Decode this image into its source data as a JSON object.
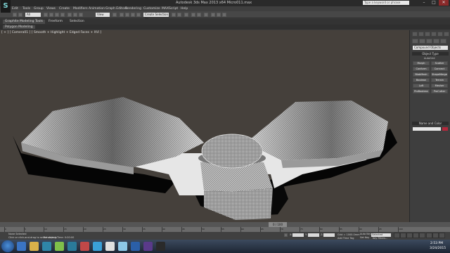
{
  "window": {
    "title": "Autodesk 3ds Max 2013 x64      Micro011.max",
    "search_placeholder": "Type a keyword or phrase",
    "minimize": "–",
    "maximize": "□",
    "close": "✕"
  },
  "app_logo": "S",
  "menu": [
    "Edit",
    "Tools",
    "Group",
    "Views",
    "Create",
    "Modifiers",
    "Animation",
    "Graph Editors",
    "Rendering",
    "Customize",
    "MAXScript",
    "Help"
  ],
  "toolbar": {
    "selection_filter": "All",
    "reference_coord": "View",
    "named_selection": "Create Selection Se"
  },
  "ribbon": {
    "tabs": [
      "Graphite Modeling Tools",
      "Freeform",
      "Selection"
    ],
    "sub_panel": "Polygon Modeling"
  },
  "viewport": {
    "label": "[ + ] [ Camera01 ] [ Smooth + Highlight + Edged Faces + XVi ]"
  },
  "command_panel": {
    "dropdown": "Compound Objects",
    "object_type_header": "Object Type",
    "autogrid": "AutoGrid",
    "buttons": [
      "Morph",
      "Scatter",
      "Conform",
      "Connect",
      "BlobMesh",
      "ShapeMerge",
      "Boolean",
      "Terrain",
      "Loft",
      "Mesher",
      "ProBoolean",
      "ProCutter"
    ],
    "name_color_header": "Name and Color"
  },
  "timeline": {
    "frame_display": "0 / 100",
    "tick_labels": [
      "0",
      "5",
      "10",
      "15",
      "20",
      "25",
      "30",
      "35",
      "40",
      "45",
      "50",
      "55",
      "60",
      "65",
      "70",
      "75",
      "80",
      "85",
      "90",
      "95",
      "100"
    ]
  },
  "status": {
    "selection": "None Selected",
    "prompt": "Click or click-and-drag to select objects",
    "render_time": "Rendering Time: 0:00:00",
    "x": "X:",
    "y": "Y:",
    "z": "Z:",
    "grid": "Grid = 1000.0mm",
    "add_time_tag": "Add Time Tag",
    "auto_key": "Auto Key",
    "set_key": "Set Key",
    "selected": "Selected",
    "key_filters": "Key Filters..."
  },
  "taskbar": {
    "time": "2:53 PM",
    "date": "3/24/2015"
  },
  "colors": {
    "viewport_bg": "#45403b",
    "ui_dark": "#3b3b3b",
    "logo_teal": "#7fd6d6",
    "accent_red": "#b3283c"
  }
}
